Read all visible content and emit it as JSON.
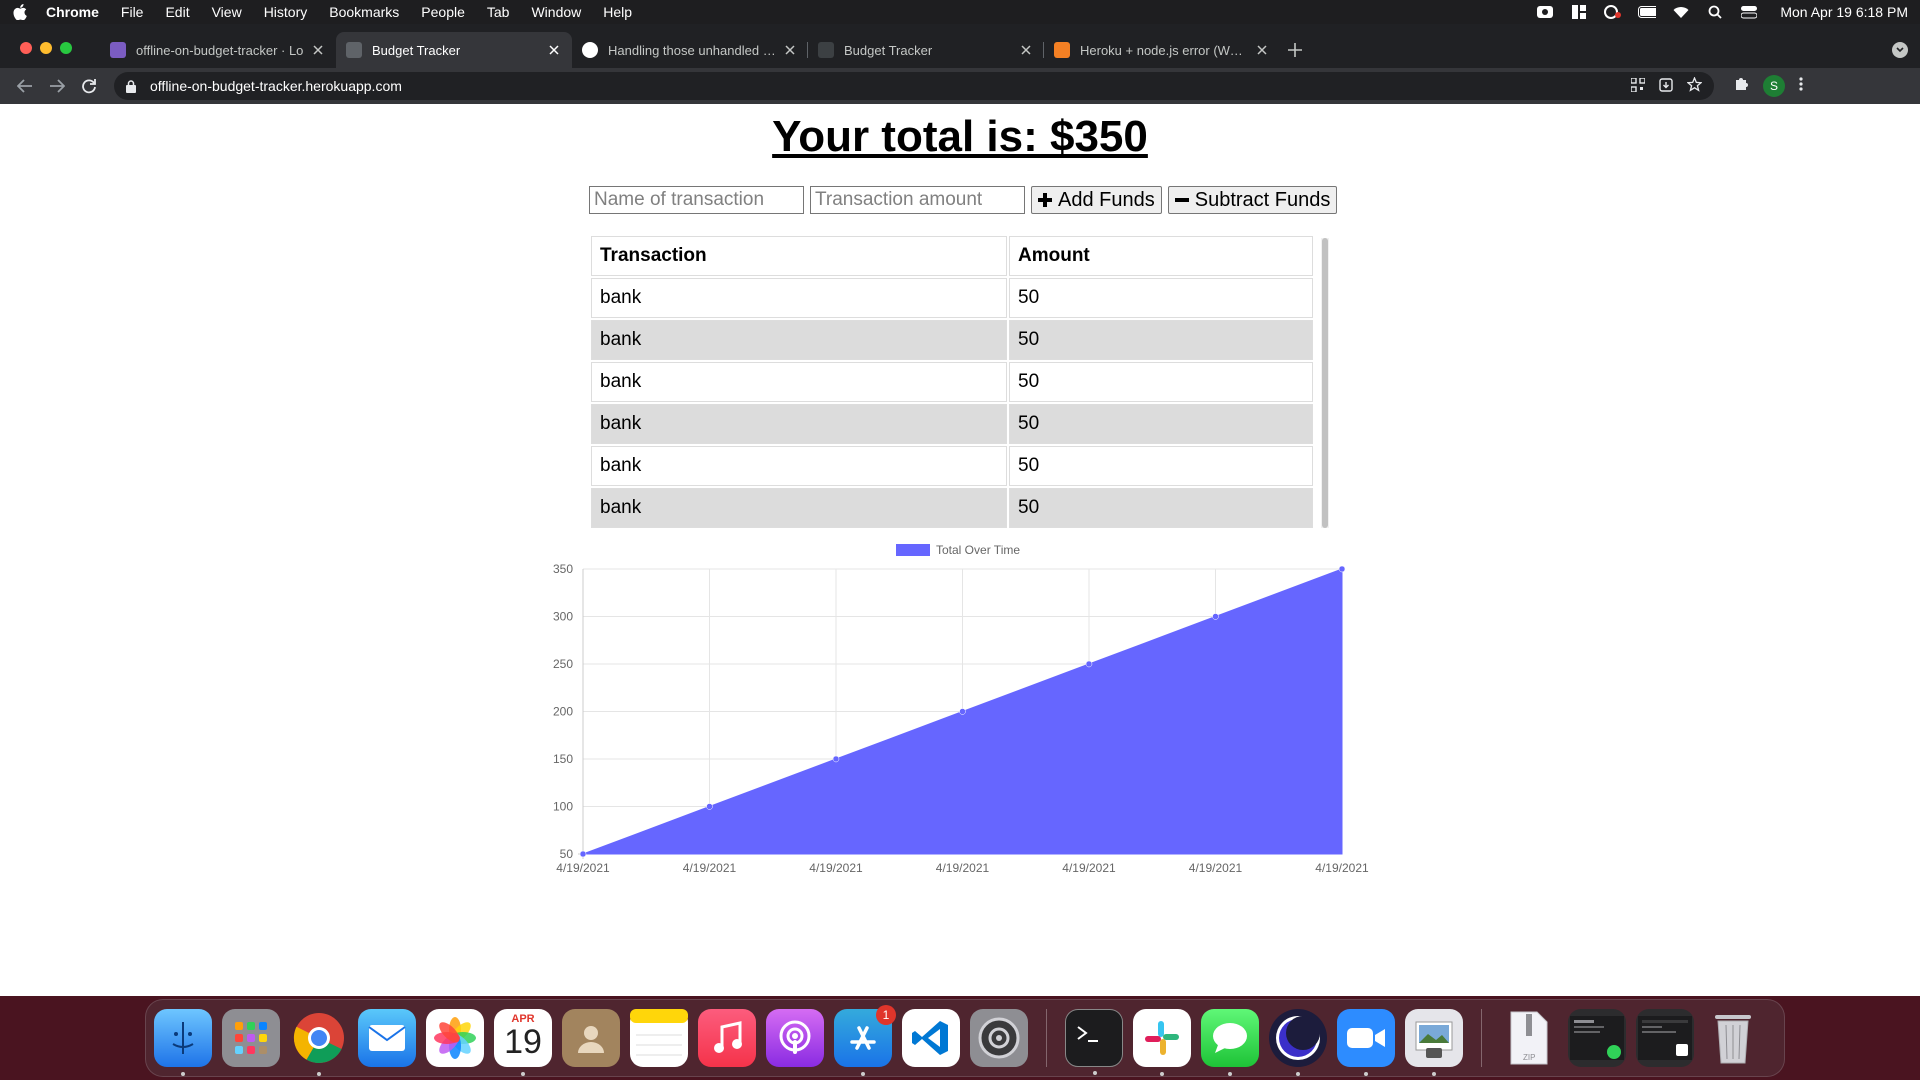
{
  "menubar": {
    "app": "Chrome",
    "items": [
      "File",
      "Edit",
      "View",
      "History",
      "Bookmarks",
      "People",
      "Tab",
      "Window",
      "Help"
    ],
    "clock": "Mon Apr 19  6:18 PM"
  },
  "tabs": [
    {
      "title": "offline-on-budget-tracker · Lo",
      "favicon_color": "#7b5cc2",
      "active": false
    },
    {
      "title": "Budget Tracker",
      "favicon_color": "#3c4043",
      "active": true
    },
    {
      "title": "Handling those unhandled pro",
      "favicon_color": "#000000",
      "active": false
    },
    {
      "title": "Budget Tracker",
      "favicon_color": "#3c4043",
      "active": false
    },
    {
      "title": "Heroku + node.js error (Web p",
      "favicon_color": "#f48024",
      "active": false
    }
  ],
  "toolbar": {
    "url": "offline-on-budget-tracker.herokuapp.com",
    "profile_initial": "S"
  },
  "page": {
    "total_text": "Your total is: $350",
    "form": {
      "name_placeholder": "Name of transaction",
      "amount_placeholder": "Transaction amount",
      "add_label": "Add Funds",
      "subtract_label": "Subtract Funds"
    },
    "table": {
      "headers": [
        "Transaction",
        "Amount"
      ],
      "rows": [
        {
          "name": "bank",
          "amount": "50"
        },
        {
          "name": "bank",
          "amount": "50"
        },
        {
          "name": "bank",
          "amount": "50"
        },
        {
          "name": "bank",
          "amount": "50"
        },
        {
          "name": "bank",
          "amount": "50"
        },
        {
          "name": "bank",
          "amount": "50"
        }
      ]
    }
  },
  "chart_data": {
    "type": "area",
    "x": [
      "4/19/2021",
      "4/19/2021",
      "4/19/2021",
      "4/19/2021",
      "4/19/2021",
      "4/19/2021",
      "4/19/2021"
    ],
    "series": [
      {
        "name": "Total Over Time",
        "values": [
          50,
          100,
          150,
          200,
          250,
          300,
          350
        ],
        "color": "#6666ff"
      }
    ],
    "ylim": [
      50,
      350
    ],
    "yticks": [
      50,
      100,
      150,
      200,
      250,
      300,
      350
    ],
    "grid": true,
    "legend": "top"
  },
  "dock": {
    "calendar_month": "APR",
    "calendar_day": "19",
    "appstore_badge": "1",
    "icons": [
      "finder-icon",
      "launchpad-icon",
      "chrome-icon",
      "mail-icon",
      "photos-icon",
      "calendar-icon",
      "contacts-icon",
      "notes-icon",
      "music-icon",
      "podcasts-icon",
      "app-store-icon",
      "vscode-icon",
      "system-preferences-icon",
      "terminal-icon",
      "slack-icon",
      "messages-icon",
      "screen-recorder-icon",
      "zoom-icon",
      "preview-icon",
      "zip-file-icon",
      "window-thumbnail-icon",
      "window-thumbnail-icon",
      "trash-icon"
    ]
  }
}
